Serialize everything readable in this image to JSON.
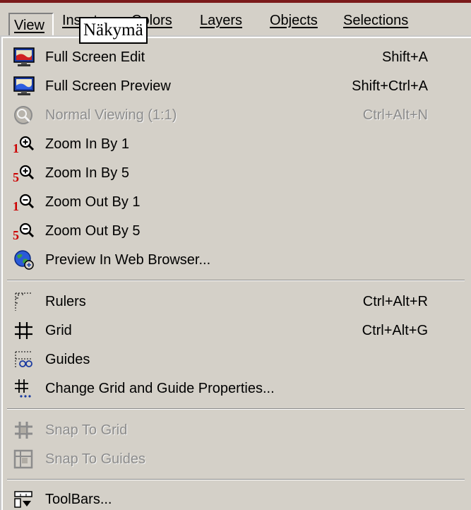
{
  "menubar": {
    "items": [
      {
        "label": "View"
      },
      {
        "label": "Insert"
      },
      {
        "label": "Colors"
      },
      {
        "label": "Layers"
      },
      {
        "label": "Objects"
      },
      {
        "label": "Selections"
      }
    ],
    "overlay_label": "Näkymä"
  },
  "menu": {
    "items": [
      {
        "label": "Full Screen Edit",
        "shortcut": "Shift+A",
        "icon": "monitor-icon",
        "enabled": true
      },
      {
        "label": "Full Screen Preview",
        "shortcut": "Shift+Ctrl+A",
        "icon": "monitor-icon",
        "enabled": true
      },
      {
        "label": "Normal Viewing (1:1)",
        "shortcut": "Ctrl+Alt+N",
        "icon": "normal-viewing-icon",
        "enabled": false
      },
      {
        "label": "Zoom In By 1",
        "shortcut": "",
        "icon": "zoom-in-1-icon",
        "enabled": true
      },
      {
        "label": "Zoom In By 5",
        "shortcut": "",
        "icon": "zoom-in-5-icon",
        "enabled": true
      },
      {
        "label": "Zoom Out By 1",
        "shortcut": "",
        "icon": "zoom-out-1-icon",
        "enabled": true
      },
      {
        "label": "Zoom Out By 5",
        "shortcut": "",
        "icon": "zoom-out-5-icon",
        "enabled": true
      },
      {
        "label": "Preview In Web Browser...",
        "shortcut": "",
        "icon": "globe-icon",
        "enabled": true
      },
      {
        "label": "Rulers",
        "shortcut": "Ctrl+Alt+R",
        "icon": "rulers-icon",
        "enabled": true
      },
      {
        "label": "Grid",
        "shortcut": "Ctrl+Alt+G",
        "icon": "grid-icon",
        "enabled": true
      },
      {
        "label": "Guides",
        "shortcut": "",
        "icon": "guides-icon",
        "enabled": true
      },
      {
        "label": "Change Grid and Guide Properties...",
        "shortcut": "",
        "icon": "grid-properties-icon",
        "enabled": true
      },
      {
        "label": "Snap To Grid",
        "shortcut": "",
        "icon": "snap-grid-icon",
        "enabled": false
      },
      {
        "label": "Snap To Guides",
        "shortcut": "",
        "icon": "snap-guides-icon",
        "enabled": false
      },
      {
        "label": "ToolBars...",
        "shortcut": "",
        "icon": "toolbars-icon",
        "enabled": true
      }
    ]
  },
  "colors": {
    "menu_background": "#d4d0c8",
    "disabled_text": "#8c8c8c",
    "title_bar_accent": "#7a1a1a",
    "icon_red": "#cc0000",
    "icon_blue": "#1a3aa0"
  }
}
